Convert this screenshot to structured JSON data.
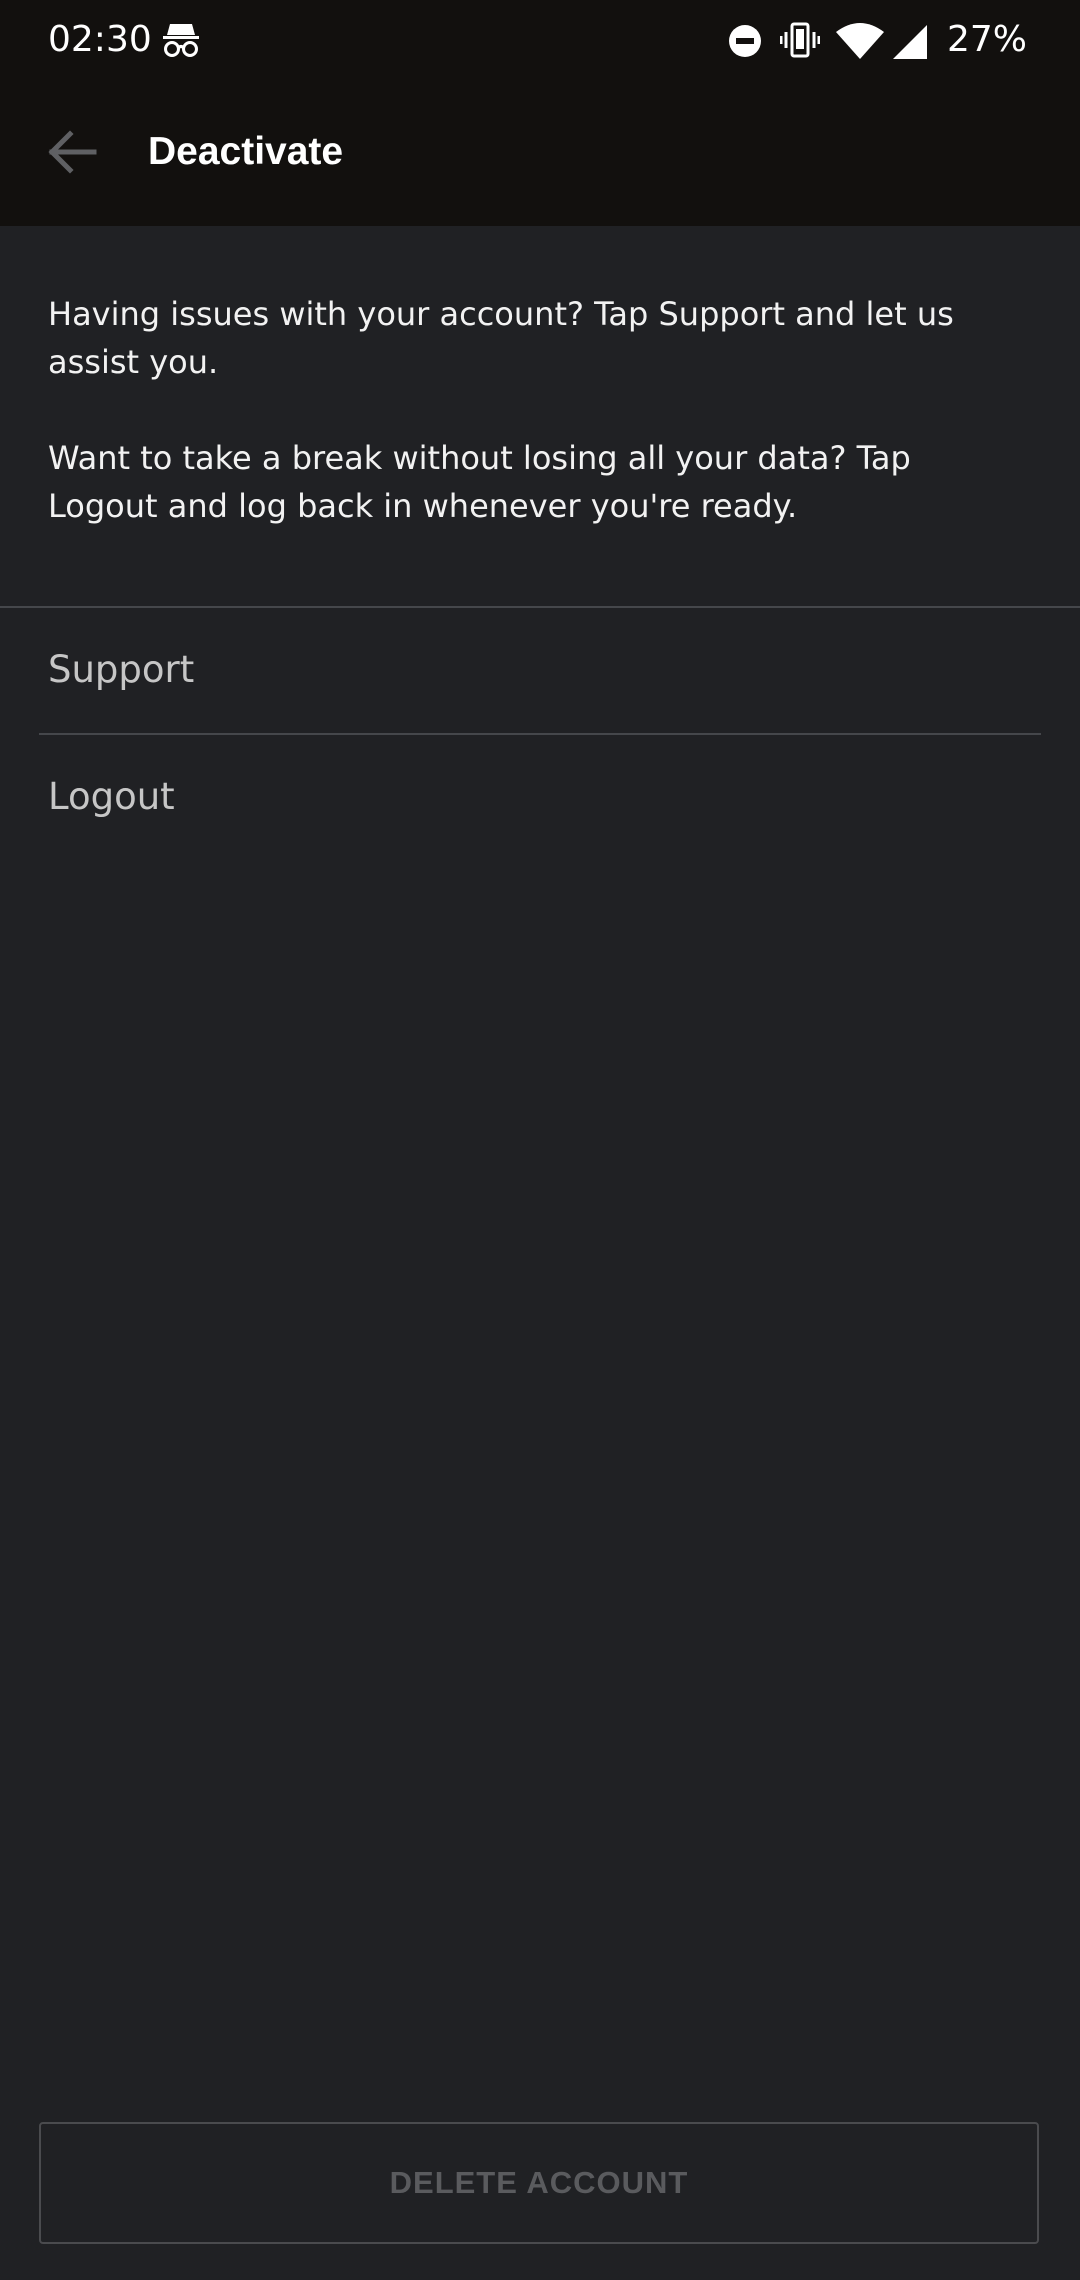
{
  "status_bar": {
    "time": "02:30",
    "battery": "27%",
    "icons": [
      "incognito-icon",
      "do-not-disturb-icon",
      "vibrate-icon",
      "wifi-icon",
      "signal-icon"
    ]
  },
  "app_bar": {
    "title": "Deactivate",
    "back_icon": "arrow-back-icon"
  },
  "description": {
    "paragraph1": "Having issues with your account? Tap Support and let us assist you.",
    "paragraph2": "Want to take a break without losing all your data? Tap Logout and log back in whenever you're ready."
  },
  "menu": {
    "items": [
      {
        "label": "Support"
      },
      {
        "label": "Logout"
      }
    ]
  },
  "delete_button": {
    "label": "DELETE ACCOUNT"
  },
  "colors": {
    "background": "#202124",
    "app_bar": "#12100e",
    "divider": "#45474b",
    "menu_text": "#c6c6c6",
    "disabled_text": "#5a5b5e"
  }
}
